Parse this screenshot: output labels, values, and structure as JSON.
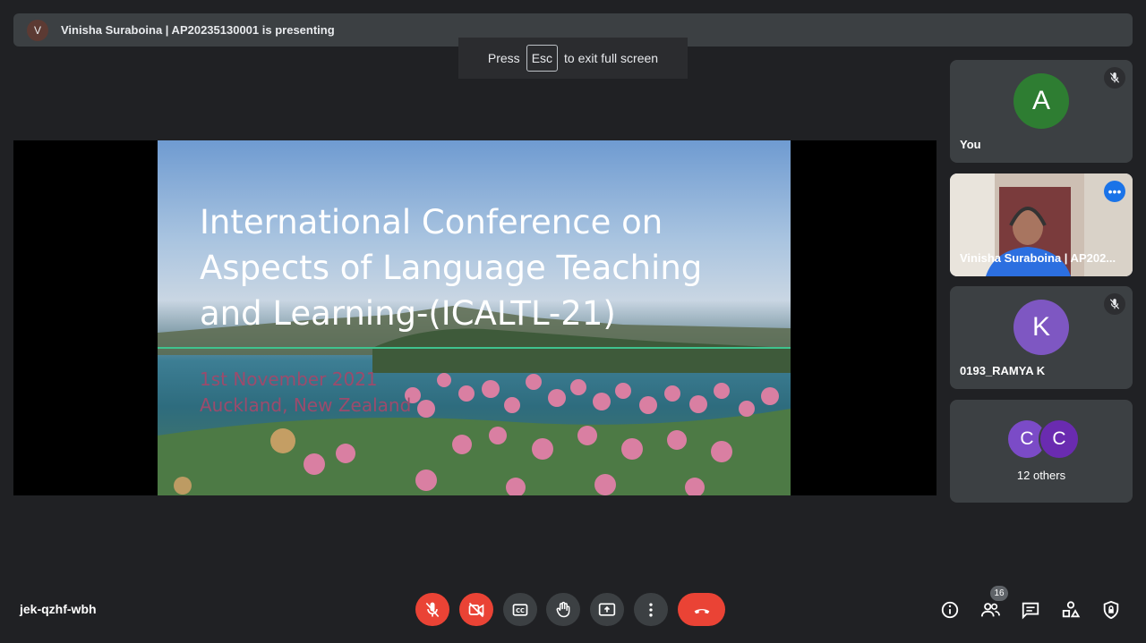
{
  "presenter_bar": {
    "avatar_letter": "V",
    "text": "Vinisha Suraboina | AP20235130001 is presenting"
  },
  "fullscreen_hint": {
    "before": "Press",
    "key": "Esc",
    "after": "to exit full screen"
  },
  "slide": {
    "title_lines": [
      "International Conference on",
      "Aspects of Language Teaching",
      "and Learning-(ICALTL-21)"
    ],
    "date": "1st November 2021",
    "place": "Auckland, New Zealand"
  },
  "participants": [
    {
      "name": "You",
      "avatar_letter": "A",
      "avatar_color": "#2e7d32",
      "muted": true
    },
    {
      "name": "Vinisha Suraboina | AP202...",
      "video": true,
      "active_speaker": true
    },
    {
      "name": "0193_RAMYA K",
      "avatar_letter": "K",
      "avatar_color": "#7e57c2",
      "muted": true
    },
    {
      "others_label": "12 others",
      "avatars": [
        {
          "letter": "C",
          "color": "#7b4bc7"
        },
        {
          "letter": "C",
          "color": "#6a2bb0"
        }
      ]
    }
  ],
  "meeting_code": "jek-qzhf-wbh",
  "controls": [
    "mic-off",
    "camera-off",
    "captions",
    "raise-hand",
    "present-now",
    "more-options",
    "leave-call"
  ],
  "right_icons": [
    "info",
    "people",
    "chat",
    "activities",
    "host-controls"
  ],
  "people_count": "16",
  "colors": {
    "background": "#202124",
    "surface": "#3c4043",
    "danger": "#ea4335",
    "accent": "#8ab4f8"
  }
}
